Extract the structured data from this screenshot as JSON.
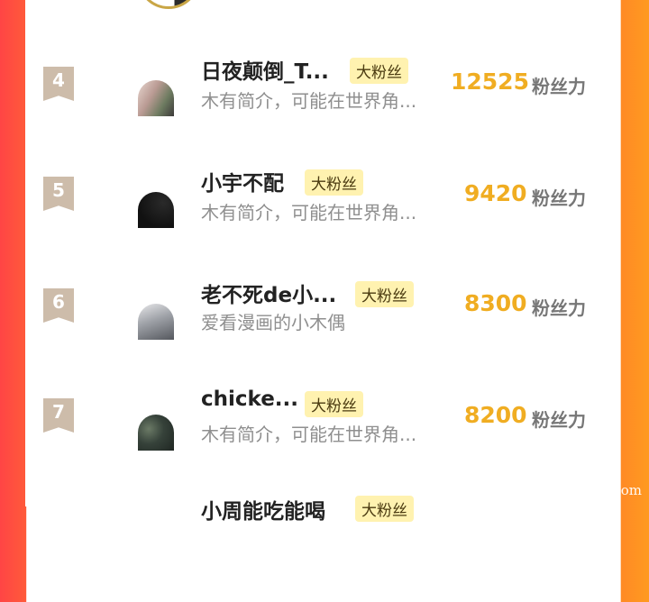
{
  "rows": [
    {
      "rank": "4",
      "name": "日夜颠倒_T...",
      "tag": "大粉丝",
      "bio": "木有简介，可能在世界角...",
      "score": "12525",
      "unit": "粉丝力"
    },
    {
      "rank": "5",
      "name": "小宇不配",
      "tag": "大粉丝",
      "bio": "木有简介，可能在世界角...",
      "score": "9420",
      "unit": "粉丝力"
    },
    {
      "rank": "6",
      "name": "老不死de小...",
      "tag": "大粉丝",
      "bio": "爱看漫画的小木偶",
      "score": "8300",
      "unit": "粉丝力"
    },
    {
      "rank": "7",
      "name": "chicke...",
      "tag": "大粉丝",
      "bio": "木有简介，可能在世界角...",
      "score": "8200",
      "unit": "粉丝力"
    },
    {
      "rank": "",
      "name": "小周能吃能喝",
      "tag": "大粉丝",
      "bio": "",
      "score": "",
      "unit": ""
    }
  ],
  "watermark": "嗨皮漫画 hipmh.com",
  "colors": {
    "accent": "#f0ad22",
    "badge": "#cdbcaa",
    "tag_bg": "#fff2b0"
  }
}
